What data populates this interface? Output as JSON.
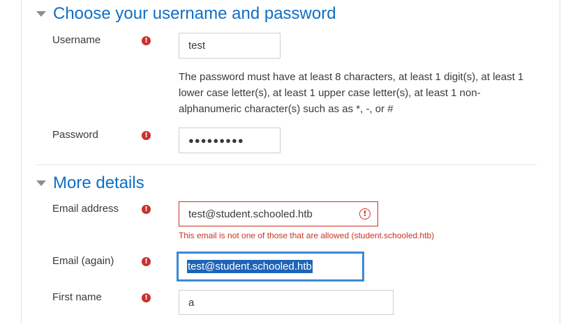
{
  "sections": {
    "credentials_title": "Choose your username and password",
    "details_title": "More details"
  },
  "username": {
    "label": "Username",
    "value": "test"
  },
  "password": {
    "help": "The password must have at least 8 characters, at least 1 digit(s), at least 1 lower case letter(s), at least 1 upper case letter(s), at least 1 non-alphanumeric character(s) such as as *, -, or #",
    "label": "Password",
    "masked_value": "●●●●●●●●●"
  },
  "email": {
    "label": "Email address",
    "value": "test@student.schooled.htb",
    "error": "This email is not one of those that are allowed (student.schooled.htb)"
  },
  "email_again": {
    "label": "Email (again)",
    "value": "test@student.schooled.htb"
  },
  "first_name": {
    "label": "First name",
    "value": "a"
  },
  "icons": {
    "required": "!",
    "error": "!"
  },
  "colors": {
    "accent": "#0f6fc5",
    "error": "#ca3120",
    "focus": "#3c88d6",
    "required": "#c9302c"
  }
}
